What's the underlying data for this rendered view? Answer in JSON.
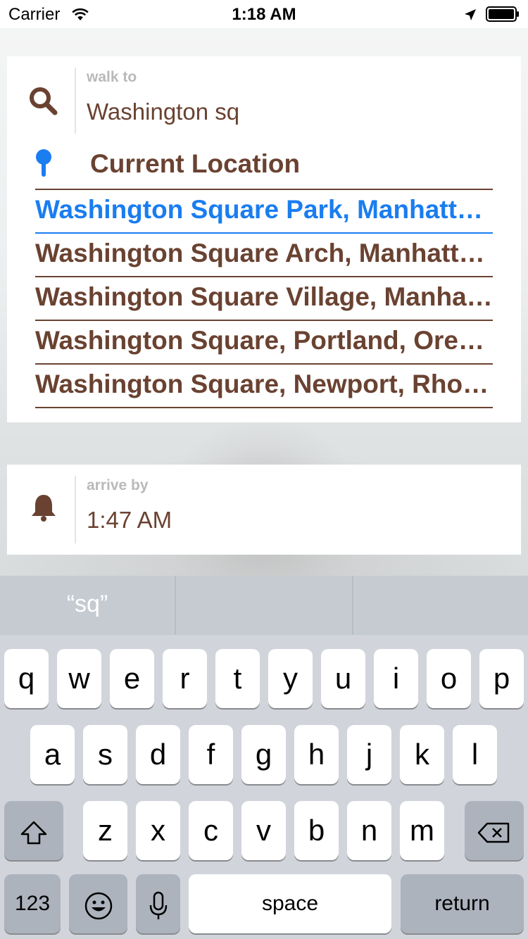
{
  "status_bar": {
    "carrier": "Carrier",
    "time": "1:18 AM"
  },
  "destination": {
    "label": "walk to",
    "value": "Washington sq",
    "current_location": "Current Location",
    "results": [
      "Washington Square Park, Manhattan, NY",
      "Washington Square Arch, Manhattan, NY",
      "Washington Square Village, Manhattan, NY",
      "Washington Square, Portland, Oregon",
      "Washington Square, Newport, Rhode Island"
    ]
  },
  "arrival": {
    "label": "arrive by",
    "value": "1:47 AM"
  },
  "keyboard": {
    "suggestions": [
      "“sq”",
      "",
      ""
    ],
    "row1": [
      "q",
      "w",
      "e",
      "r",
      "t",
      "y",
      "u",
      "i",
      "o",
      "p"
    ],
    "row2": [
      "a",
      "s",
      "d",
      "f",
      "g",
      "h",
      "j",
      "k",
      "l"
    ],
    "row3": [
      "z",
      "x",
      "c",
      "v",
      "b",
      "n",
      "m"
    ],
    "numbers_label": "123",
    "space_label": "space",
    "return_label": "return"
  },
  "icons": {
    "search": "search-icon",
    "pin": "pin-icon",
    "bell": "bell-icon",
    "shift": "shift-icon",
    "delete": "delete-icon",
    "emoji": "emoji-icon",
    "mic": "mic-icon"
  },
  "colors": {
    "brown": "#6a4231",
    "selected": "#1a7df0",
    "label_gray": "#b9b9b9"
  }
}
